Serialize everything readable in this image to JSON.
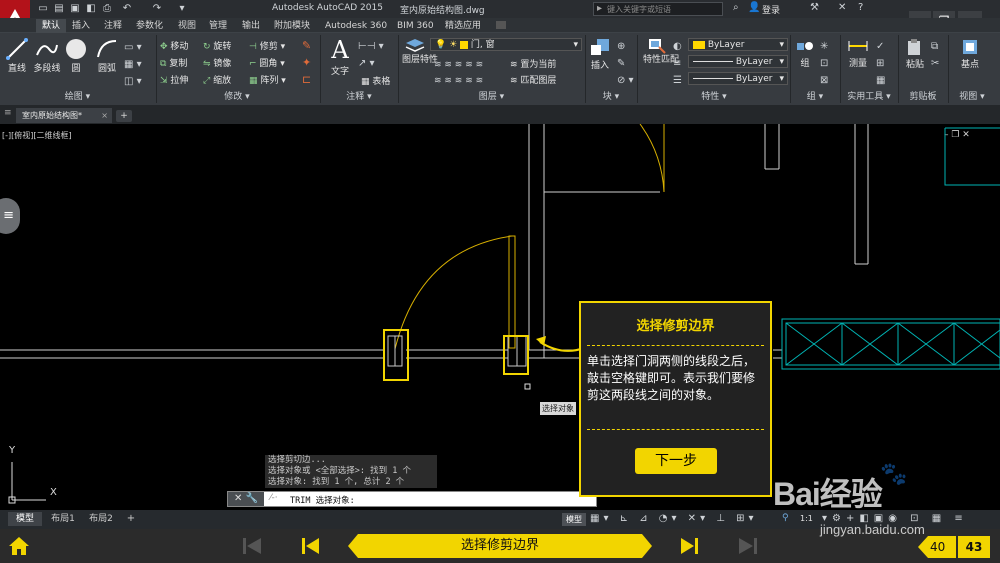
{
  "app": {
    "title": "Autodesk AutoCAD 2015",
    "filename": "室内原始结构图.dwg",
    "search_placeholder": "键入关键字或短语",
    "login": "登录"
  },
  "ribbon_tabs": [
    "默认",
    "插入",
    "注释",
    "参数化",
    "视图",
    "管理",
    "输出",
    "附加模块",
    "Autodesk 360",
    "BIM 360",
    "精选应用"
  ],
  "panels": {
    "draw": {
      "title": "绘图",
      "tools": [
        "直线",
        "多段线",
        "圆",
        "圆弧"
      ]
    },
    "modify": {
      "title": "修改",
      "tools": [
        "移动",
        "旋转",
        "修剪",
        "复制",
        "镜像",
        "圆角",
        "拉伸",
        "缩放",
        "阵列"
      ]
    },
    "annotation": {
      "title": "注释",
      "tools": [
        "文字",
        "表格"
      ]
    },
    "layers": {
      "title": "图层",
      "tools": [
        "图层特性",
        "置为当前",
        "匹配图层"
      ],
      "current_layer": "门, 窗"
    },
    "block": {
      "title": "块",
      "tools": [
        "插入"
      ]
    },
    "properties": {
      "title": "特性",
      "tools": [
        "特性匹配"
      ],
      "color": "ByLayer",
      "linetype": "ByLayer",
      "lineweight": "ByLayer"
    },
    "groups": {
      "title": "组",
      "tools": [
        "组"
      ]
    },
    "utilities": {
      "title": "实用工具",
      "tools": [
        "测量"
      ]
    },
    "clipboard": {
      "title": "剪贴板",
      "tools": [
        "粘贴"
      ]
    },
    "view": {
      "title": "视图",
      "tools": [
        "基点"
      ]
    }
  },
  "doc_tab": "室内原始结构图*",
  "viewport_label": "[-][俯视][二维线框]",
  "cursor_tooltip": "选择对象",
  "command_history": [
    "选择剪切边...",
    "选择对象或 <全部选择>: 找到 1 个",
    "选择对象: 找到 1 个, 总计 2 个"
  ],
  "command_prompt": "TRIM 选择对象:",
  "layout_tabs": [
    "模型",
    "布局1",
    "布局2"
  ],
  "status": {
    "model": "模型",
    "scale": "1:1"
  },
  "ucs": {
    "x": "X",
    "y": "Y"
  },
  "popup": {
    "title": "选择修剪边界",
    "body": "单击选择门洞两侧的线段之后，敲击空格键即可。表示我们要修剪这两段线之间的对象。",
    "next_button": "下一步"
  },
  "bottom_nav": {
    "step_title": "选择修剪边界",
    "current": "40",
    "total": "43"
  },
  "watermark": {
    "text": "Bai经验",
    "url": "jingyan.baidu.com"
  },
  "colors": {
    "accent_yellow": "#f2d500",
    "cyan_lines": "#00b3b3",
    "autocad_red": "#b3121a"
  }
}
